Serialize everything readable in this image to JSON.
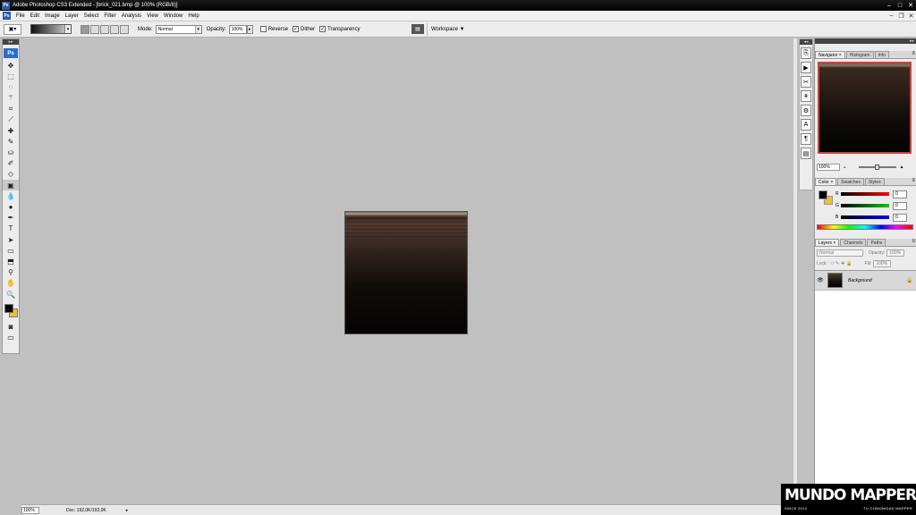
{
  "window": {
    "title": "Adobe Photoshop CS3 Extended - [brick_021.bmp @ 100% (RGB/8)]",
    "app_icon": "Ps",
    "controls": [
      "minimize-icon",
      "maximize-icon",
      "close-icon"
    ]
  },
  "menu": {
    "app_icon": "Ps",
    "items": [
      "File",
      "Edit",
      "Image",
      "Layer",
      "Select",
      "Filter",
      "Analysis",
      "View",
      "Window",
      "Help"
    ]
  },
  "options": {
    "mode_label": "Mode:",
    "mode_value": "Normal",
    "opacity_label": "Opacity:",
    "opacity_value": "100%",
    "reverse_label": "Reverse",
    "reverse_checked": false,
    "dither_label": "Dither",
    "dither_checked": true,
    "transparency_label": "Transparency",
    "transparency_checked": true,
    "workspace_label": "Workspace ▼"
  },
  "toolbox": {
    "badge": "Ps",
    "foreground_color": "#000000",
    "background_color": "#e8c040",
    "active_tool": "gradient-tool"
  },
  "status": {
    "zoom": "100%",
    "doc": "Doc: 192,0K/192,0K"
  },
  "navigator": {
    "tabs": [
      "Navigator",
      "Histogram",
      "Info"
    ],
    "zoom": "100%"
  },
  "color_panel": {
    "tabs": [
      "Color",
      "Swatches",
      "Styles"
    ],
    "r": "0",
    "g": "0",
    "b": "0",
    "r_label": "R",
    "g_label": "G",
    "b_label": "B"
  },
  "layers_panel": {
    "tabs": [
      "Layers",
      "Channels",
      "Paths"
    ],
    "blend_mode": "Normal",
    "opacity_label": "Opacity:",
    "opacity_value": "100%",
    "lock_label": "Lock:",
    "fill_label": "Fill:",
    "fill_value": "100%",
    "layers": [
      {
        "name": "Background",
        "visible": true,
        "locked": true
      }
    ]
  },
  "watermark": {
    "brand": "MUNDO MAPPER",
    "since": "SINCE 2014",
    "tagline": "TU COMUNIDAD MAPPER"
  },
  "colors": {
    "titlebar": "#000000",
    "canvas_bg": "#c0c0c0",
    "panel_bg": "#ececec",
    "ps_blue": "#2a6ec8",
    "accent_red": "#d04040"
  }
}
